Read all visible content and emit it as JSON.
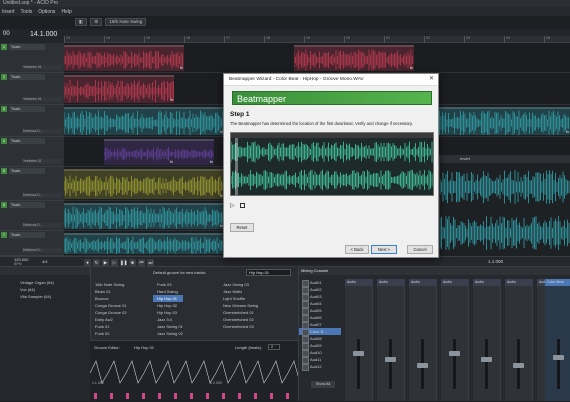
{
  "app": {
    "title": "Untitled.sop * - ACID Pro"
  },
  "menu": [
    "Insert",
    "Tools",
    "Options",
    "Help"
  ],
  "toolbar": {
    "groove_label": "16th Note Swing"
  },
  "time": {
    "position": "14.1.000"
  },
  "ruler": {
    "ticks": [
      "13",
      "14",
      "15",
      "16",
      "17",
      "18",
      "19",
      "20",
      "21",
      "22",
      "23",
      "24",
      "25"
    ]
  },
  "tracks": [
    {
      "num": "1",
      "name": "Touch",
      "sub": "Yeekrebo 01",
      "color": "#a8364a"
    },
    {
      "num": "2",
      "name": "Touch",
      "sub": "Yeekrebo 01",
      "color": "#a8364a"
    },
    {
      "num": "3",
      "name": "Touch",
      "sub": "Delicious D...",
      "color": "#2e8c95"
    },
    {
      "num": "4",
      "name": "Touch",
      "sub": "Yeekrebo 01",
      "color": "#5a3c8c"
    },
    {
      "num": "5",
      "name": "Touch",
      "sub": "Delicious D...",
      "color": "#8a8a2e"
    },
    {
      "num": "6",
      "name": "Touch",
      "sub": "Delicious D...",
      "color": "#2e8c95"
    },
    {
      "num": "7",
      "name": "Touch",
      "sub": "Delicious D...",
      "color": "#2e8c95"
    }
  ],
  "transport": {
    "tempo": "120.000",
    "bpm_label": "BPM",
    "time": "4/4",
    "position2": "1.1.000"
  },
  "library": {
    "items": [
      "Vintage Organ (64)",
      "Vox (64)",
      "Vita Sampler (64)"
    ]
  },
  "groove_pool": {
    "header": "Default groove for new tracks:",
    "current": "Hip Hop 01",
    "col1": [
      "16th Note Swing",
      "Blues 01",
      "Bounce",
      "Conga Groove 01",
      "Conga Groove 02",
      "Early Aw2",
      "Funk 01",
      "Funk 02"
    ],
    "col2": [
      "Funk 03",
      "Hard Swing",
      "Hip Hop 01",
      "Hip Hop 02",
      "Hip Hop 03",
      "Jazz 3:4",
      "Jazz Swing 01",
      "Jazz Swing 02"
    ],
    "col3": [
      "Jazz Swing 03",
      "Jazz Waltz",
      "Light Shuffle",
      "New Orleans Swing",
      "Overstretched 01",
      "Overstretched 02",
      "Overstretched 03"
    ]
  },
  "groove_editor": {
    "label": "Groove Editor:",
    "name": "Hip Hop 01",
    "length_label": "Length (beats):",
    "length": "2",
    "pos1": "1.1.000",
    "pos2": "1.2.000"
  },
  "mixer": {
    "title": "Mixing Console",
    "tracks": [
      "Aud01",
      "Aud02",
      "Aud03",
      "Aud04",
      "Aud05",
      "Aud06",
      "Aud07",
      "Color B...",
      "Aud08",
      "Aud09",
      "Aud10",
      "Aud11",
      "Aud12"
    ],
    "show_all": "Show All",
    "strips": [
      "Audio",
      "Audio",
      "Audio",
      "Audio",
      "Audio",
      "Audio",
      "Audio"
    ],
    "bus_label": "Color Beat"
  },
  "dialog": {
    "title": "Beatmapper Wizard - Color Beat - HipHop - Groove Mono.WAV",
    "banner": "Beatmapper",
    "step": "Step 1",
    "description": "The Beatmapper has determined the location of the first downbeat. Verify and change if necessary.",
    "reset_label": "Reset",
    "back_label": "< Back",
    "next_label": "Next >",
    "cancel_label": "Cancel"
  },
  "side_panel": {
    "label": "Invert"
  },
  "colors": {
    "accent": "#4b78b5",
    "dialog_green": "#56b34d"
  }
}
